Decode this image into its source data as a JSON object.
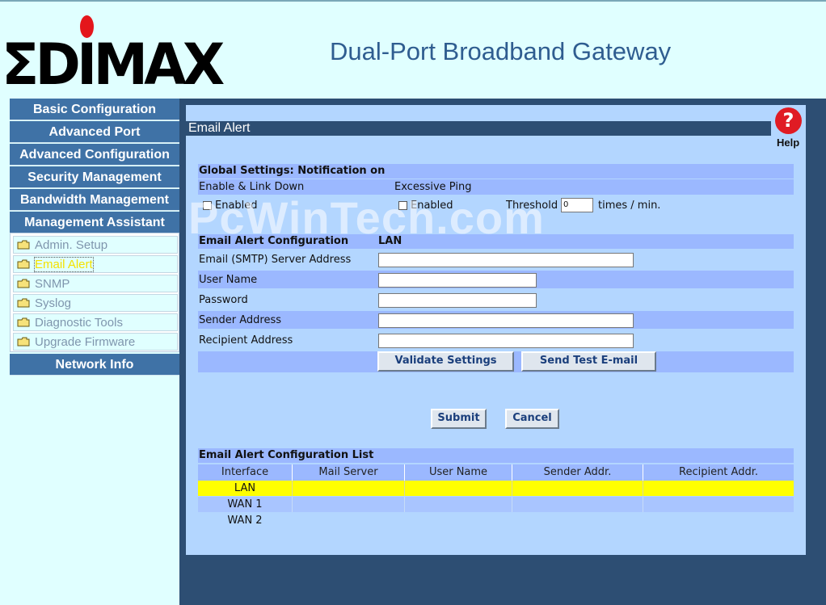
{
  "header": {
    "brand": "ΣDIMAX",
    "product_title": "Dual-Port Broadband Gateway"
  },
  "sidebar": {
    "menu": [
      {
        "label": "Basic Configuration"
      },
      {
        "label": "Advanced Port"
      },
      {
        "label": "Advanced Configuration"
      },
      {
        "label": "Security Management"
      },
      {
        "label": "Bandwidth Management"
      },
      {
        "label": "Management Assistant"
      }
    ],
    "sub_items": [
      {
        "label": "Admin. Setup",
        "icon": "folder-icon"
      },
      {
        "label": "Email Alert",
        "icon": "folder-icon",
        "active": true
      },
      {
        "label": "SNMP",
        "icon": "folder-icon"
      },
      {
        "label": "Syslog",
        "icon": "folder-icon"
      },
      {
        "label": "Diagnostic Tools",
        "icon": "folder-icon"
      },
      {
        "label": "Upgrade Firmware",
        "icon": "folder-icon"
      }
    ],
    "network_info": "Network Info"
  },
  "page": {
    "title": "Email Alert",
    "help": "Help",
    "watermark": "PcWinTech.com"
  },
  "global": {
    "header": "Global Settings: Notification on",
    "link_down_label": "Enable & Link Down",
    "ping_label": "Excessive Ping",
    "enabled_label": "Enabled",
    "ping_enabled_label": "Enabled",
    "threshold_label": "Threshold",
    "threshold_value": "0",
    "threshold_unit": "times / min."
  },
  "config": {
    "header": "Email Alert Configuration",
    "interface": "LAN",
    "smtp_label": "Email (SMTP) Server Address",
    "smtp_value": "",
    "user_label": "User Name",
    "user_value": "",
    "password_label": "Password",
    "password_value": "",
    "sender_label": "Sender Address",
    "sender_value": "",
    "recipient_label": "Recipient Address",
    "recipient_value": "",
    "validate_button": "Validate Settings",
    "test_button": "Send Test E-mail"
  },
  "actions": {
    "submit": "Submit",
    "cancel": "Cancel"
  },
  "list": {
    "header": "Email Alert Configuration List",
    "columns": [
      "Interface",
      "Mail Server",
      "User Name",
      "Sender Addr.",
      "Recipient Addr."
    ],
    "rows": [
      {
        "interface": "LAN",
        "selected": true
      },
      {
        "interface": "WAN 1"
      },
      {
        "interface": "WAN 2"
      }
    ]
  },
  "colors": {
    "nav_bg": "#3f72a6",
    "page_bg": "#2d4e73",
    "header_bg": "#e0ffff",
    "content_bg": "#b3d6ff",
    "row_bg": "#9bb8ff",
    "selected_row": "#ffff00",
    "help_icon": "#e01b24"
  }
}
